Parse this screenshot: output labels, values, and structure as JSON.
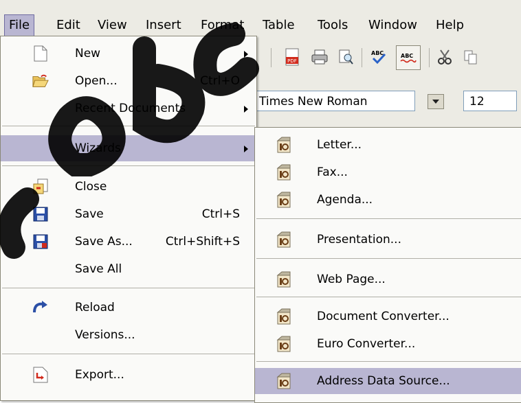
{
  "menubar": {
    "items": [
      "File",
      "Edit",
      "View",
      "Insert",
      "Format",
      "Table",
      "Tools",
      "Window",
      "Help"
    ]
  },
  "toolbar": {
    "icons": [
      "export-pdf-icon",
      "print-icon",
      "page-preview-icon",
      "spellcheck-icon",
      "autospellcheck-icon",
      "cut-icon",
      "copy-icon"
    ]
  },
  "formatting": {
    "font_name": "Times New Roman",
    "font_size": "12"
  },
  "file_menu": {
    "items": [
      {
        "label": "New",
        "shortcut": "",
        "submenu": true,
        "icon": "new-document-icon"
      },
      {
        "label": "Open...",
        "shortcut": "Ctrl+O",
        "submenu": false,
        "icon": "open-folder-icon"
      },
      {
        "label": "Recent Documents",
        "shortcut": "",
        "submenu": true,
        "icon": ""
      },
      {
        "label": "Wizards",
        "shortcut": "",
        "submenu": true,
        "icon": ""
      },
      {
        "label": "Close",
        "shortcut": "",
        "submenu": false,
        "icon": "close-document-icon"
      },
      {
        "label": "Save",
        "shortcut": "Ctrl+S",
        "submenu": false,
        "icon": "save-icon"
      },
      {
        "label": "Save As...",
        "shortcut": "Ctrl+Shift+S",
        "submenu": false,
        "icon": "save-as-icon"
      },
      {
        "label": "Save All",
        "shortcut": "",
        "submenu": false,
        "icon": ""
      },
      {
        "label": "Reload",
        "shortcut": "",
        "submenu": false,
        "icon": "reload-icon"
      },
      {
        "label": "Versions...",
        "shortcut": "",
        "submenu": false,
        "icon": ""
      },
      {
        "label": "Export...",
        "shortcut": "",
        "submenu": false,
        "icon": "export-icon"
      }
    ]
  },
  "wizards_menu": {
    "items": [
      {
        "label": "Letter..."
      },
      {
        "label": "Fax..."
      },
      {
        "label": "Agenda..."
      },
      {
        "label": "Presentation..."
      },
      {
        "label": "Web Page..."
      },
      {
        "label": "Document Converter..."
      },
      {
        "label": "Euro Converter..."
      },
      {
        "label": "Address Data Source..."
      }
    ],
    "icon": "wizard-icon"
  },
  "colors": {
    "highlight": "#b9b6d2",
    "menubar_bg": "#ecebe4",
    "menu_bg": "#fafaf8"
  }
}
